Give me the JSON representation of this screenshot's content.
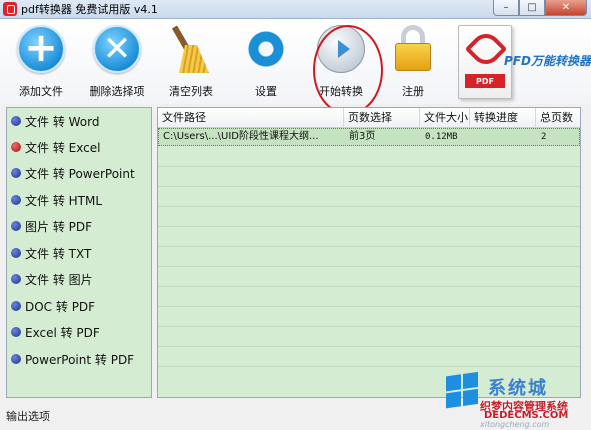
{
  "window": {
    "title": "pdf转换器 免费试用版 v4.1",
    "min_label": "–",
    "max_label": "□",
    "close_label": "✕"
  },
  "toolbar": {
    "add_file": "添加文件",
    "remove_selected": "删除选择项",
    "clear_list": "清空列表",
    "settings": "设置",
    "start_convert": "开始转换",
    "register": "注册",
    "pdf_tag": "PDF",
    "brand": "PFD万能转换器"
  },
  "conversions": [
    {
      "label": "文件 转 Word",
      "selected": false
    },
    {
      "label": "文件 转 Excel",
      "selected": true
    },
    {
      "label": "文件 转 PowerPoint",
      "selected": false
    },
    {
      "label": "文件 转 HTML",
      "selected": false
    },
    {
      "label": "图片 转 PDF",
      "selected": false
    },
    {
      "label": "文件 转 TXT",
      "selected": false
    },
    {
      "label": "文件 转 图片",
      "selected": false
    },
    {
      "label": "DOC 转 PDF",
      "selected": false
    },
    {
      "label": "Excel 转 PDF",
      "selected": false
    },
    {
      "label": "PowerPoint 转 PDF",
      "selected": false
    }
  ],
  "table": {
    "columns": [
      "文件路径",
      "页数选择",
      "文件大小",
      "转换进度",
      "总页数"
    ],
    "rows": [
      [
        "C:\\Users\\...\\UID阶段性课程大纲...",
        "前3页",
        "0.12MB",
        "",
        "2"
      ]
    ]
  },
  "footer": {
    "output_options": "输出选项"
  },
  "watermark": {
    "title": "系统城",
    "line1": "织梦内容管理系统",
    "line2": "DEDECMS.COM",
    "url": "xitongcheng.com"
  }
}
